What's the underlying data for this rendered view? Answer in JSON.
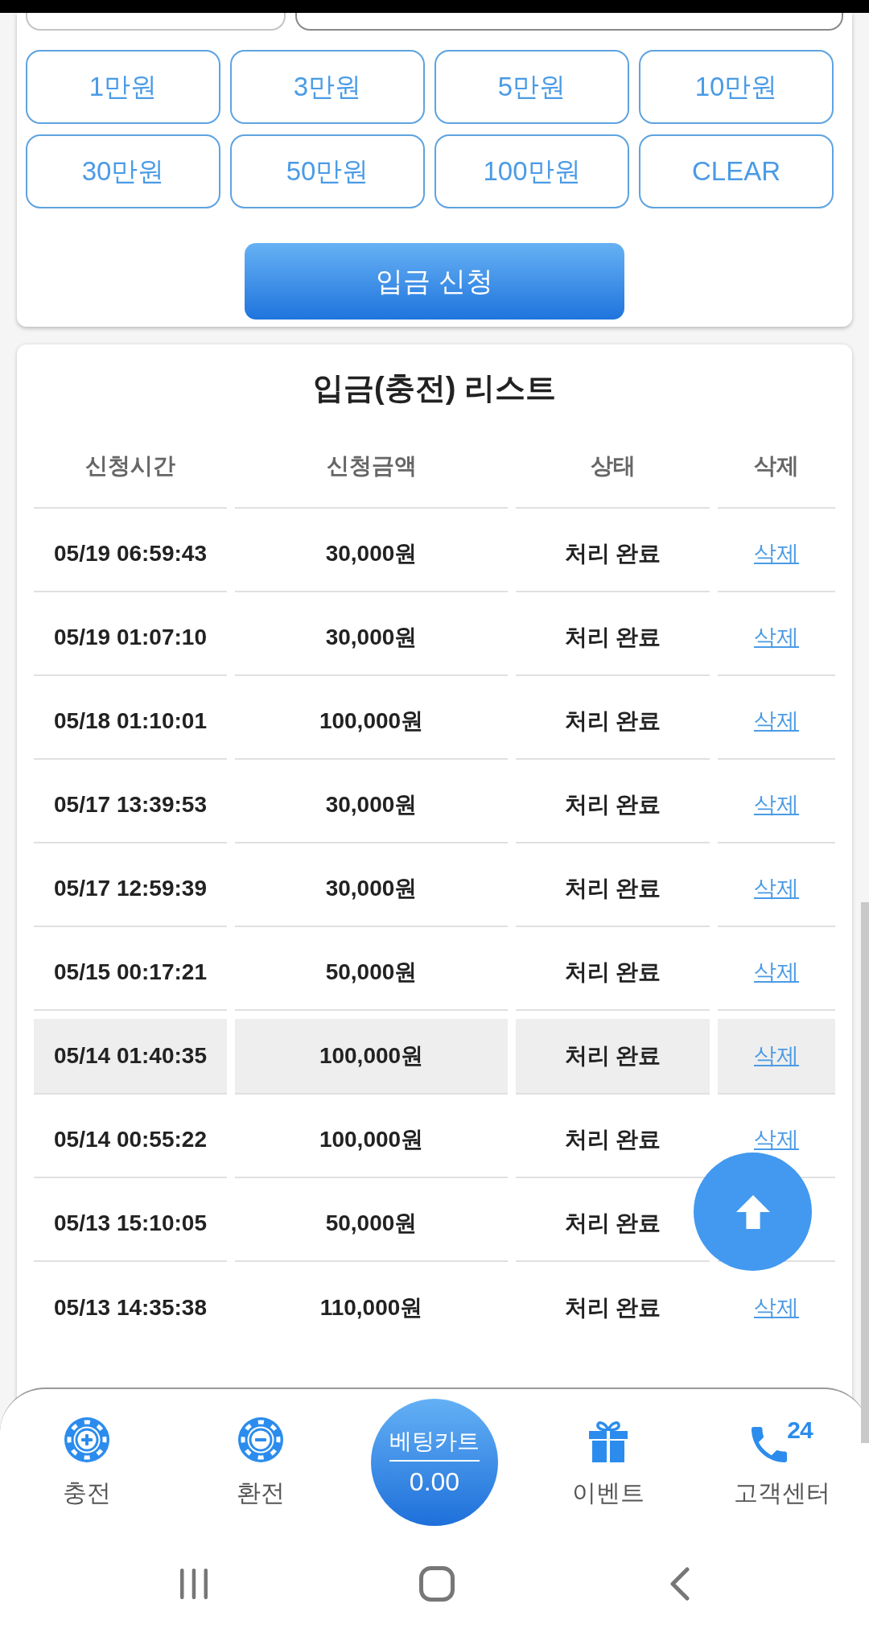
{
  "top_fields": [
    {
      "kind": "select"
    },
    {
      "kind": "input"
    }
  ],
  "preset_buttons": [
    "1만원",
    "3만원",
    "5만원",
    "10만원",
    "30만원",
    "50만원",
    "100만원",
    "CLEAR"
  ],
  "submit_button": "입금 신청",
  "list": {
    "title": "입금(충전) 리스트",
    "columns": [
      "신청시간",
      "신청금액",
      "상태",
      "삭제"
    ],
    "rows": [
      {
        "time": "05/19 06:59:43",
        "amount": "30,000원",
        "status": "처리 완료",
        "delete": "삭제",
        "selected": false
      },
      {
        "time": "05/19 01:07:10",
        "amount": "30,000원",
        "status": "처리 완료",
        "delete": "삭제",
        "selected": false
      },
      {
        "time": "05/18 01:10:01",
        "amount": "100,000원",
        "status": "처리 완료",
        "delete": "삭제",
        "selected": false
      },
      {
        "time": "05/17 13:39:53",
        "amount": "30,000원",
        "status": "처리 완료",
        "delete": "삭제",
        "selected": false
      },
      {
        "time": "05/17 12:59:39",
        "amount": "30,000원",
        "status": "처리 완료",
        "delete": "삭제",
        "selected": false
      },
      {
        "time": "05/15 00:17:21",
        "amount": "50,000원",
        "status": "처리 완료",
        "delete": "삭제",
        "selected": false
      },
      {
        "time": "05/14 01:40:35",
        "amount": "100,000원",
        "status": "처리 완료",
        "delete": "삭제",
        "selected": true
      },
      {
        "time": "05/14 00:55:22",
        "amount": "100,000원",
        "status": "처리 완료",
        "delete": "삭제",
        "selected": false
      },
      {
        "time": "05/13 15:10:05",
        "amount": "50,000원",
        "status": "처리 완료",
        "selected": false
      },
      {
        "time": "05/13 14:35:38",
        "amount": "110,000원",
        "status": "처리 완료",
        "delete": "삭제",
        "selected": false
      }
    ]
  },
  "bottom_nav": {
    "items": [
      {
        "kind": "chip-plus",
        "label": "충전"
      },
      {
        "kind": "chip-minus",
        "label": "환전"
      },
      {
        "kind": "cart",
        "title": "베팅카트",
        "value": "0.00"
      },
      {
        "kind": "gift",
        "label": "이벤트"
      },
      {
        "kind": "phone",
        "label": "고객센터",
        "hours": "24"
      }
    ]
  }
}
